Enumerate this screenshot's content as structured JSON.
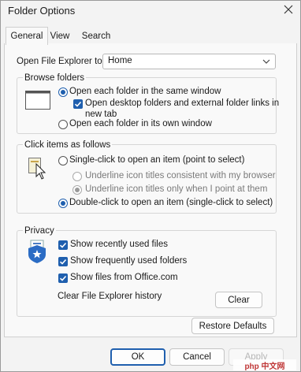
{
  "window": {
    "title": "Folder Options"
  },
  "tabs": [
    {
      "label": "General",
      "active": true
    },
    {
      "label": "View",
      "active": false
    },
    {
      "label": "Search",
      "active": false
    }
  ],
  "open_explorer": {
    "label": "Open File Explorer to:",
    "value": "Home"
  },
  "browse": {
    "title": "Browse folders",
    "same_window": "Open each folder in the same window",
    "desktop_links_line1": "Open desktop folders and external folder links in",
    "desktop_links_line2": "new tab",
    "own_window": "Open each folder in its own window"
  },
  "click": {
    "title": "Click items as follows",
    "single": "Single-click to open an item (point to select)",
    "underline_browser": "Underline icon titles consistent with my browser",
    "underline_point": "Underline icon titles only when I point at them",
    "double": "Double-click to open an item (single-click to select)"
  },
  "privacy": {
    "title": "Privacy",
    "recent_files": "Show recently used files",
    "frequent_folders": "Show frequently used folders",
    "office_files": "Show files from Office.com",
    "clear_label": "Clear File Explorer history",
    "clear_button": "Clear"
  },
  "buttons": {
    "restore": "Restore Defaults",
    "ok": "OK",
    "cancel": "Cancel",
    "apply": "Apply"
  },
  "watermark": "php 中文网",
  "colors": {
    "accent": "#1f5fae",
    "panel": "#f9f9f9",
    "window": "#f3f3f3"
  }
}
